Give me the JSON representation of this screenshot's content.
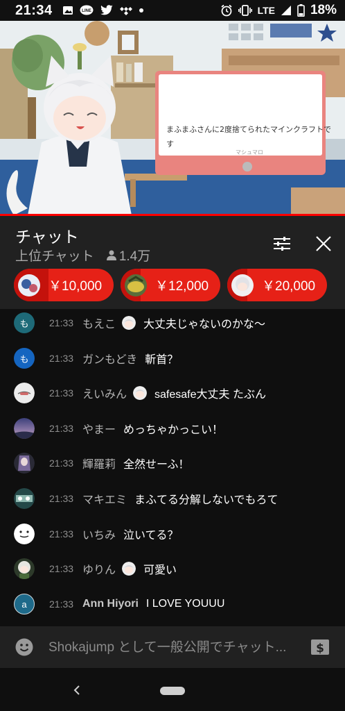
{
  "status_bar": {
    "time": "21:34",
    "network": "LTE",
    "battery": "18%",
    "left_icons": [
      "image-icon",
      "line-app-icon",
      "twitter-icon",
      "tidal-icon",
      "dot-icon"
    ],
    "right_icons": [
      "alarm-icon",
      "vibrate-icon",
      "signal-icon",
      "battery-icon"
    ]
  },
  "video": {
    "overlay_text": "まふまふさんに2度捨てられたマインクラフトです",
    "overlay_sub": "マシュマロ"
  },
  "chat": {
    "title": "チャット",
    "mode": "上位チャット",
    "viewers": "1.4万",
    "tickers": [
      {
        "amount": "￥10,000",
        "progress": 0.35
      },
      {
        "amount": "￥12,000",
        "progress": 0.2
      },
      {
        "amount": "￥20,000",
        "progress": 0.2
      }
    ],
    "messages": [
      {
        "time": "21:33",
        "author": "もえこ",
        "avatar_letter": "も",
        "avatar_color": "#1e6a78",
        "member_badge": true,
        "text": "大丈夫じゃないのかな～"
      },
      {
        "time": "21:33",
        "author": "ガンもどき",
        "avatar_letter": "も",
        "avatar_color": "#1565c0",
        "member_badge": false,
        "text": "斬首？"
      },
      {
        "time": "21:33",
        "author": "えいみん",
        "avatar_letter": "",
        "avatar_color": "#e8e8e8",
        "member_badge": true,
        "text": "safesafe大丈夫 たぶん"
      },
      {
        "time": "21:33",
        "author": "やまー",
        "avatar_letter": "",
        "avatar_color": "#5a5c8c",
        "member_badge": false,
        "text": "めっちゃかっこい！"
      },
      {
        "time": "21:33",
        "author": "輝羅莉",
        "avatar_letter": "",
        "avatar_color": "#3a3a4a",
        "member_badge": false,
        "text": "全然せーふ！"
      },
      {
        "time": "21:33",
        "author": "マキエミ",
        "avatar_letter": "",
        "avatar_color": "#2d5a5a",
        "member_badge": false,
        "text": "まふてる分解しないでもろて"
      },
      {
        "time": "21:33",
        "author": "いちみ",
        "avatar_letter": "",
        "avatar_color": "#ffffff",
        "member_badge": false,
        "text": "泣いてる？"
      },
      {
        "time": "21:33",
        "author": "ゆりん",
        "avatar_letter": "",
        "avatar_color": "#d8d0c0",
        "member_badge": true,
        "text": "可愛い"
      },
      {
        "time": "21:33",
        "author": "Ann Hiyori",
        "avatar_letter": "a",
        "avatar_color": "#1e6a8a",
        "member_badge": false,
        "text": "I LOVE YOUUU"
      }
    ],
    "input_placeholder": "Shokajump として一般公開でチャット..."
  },
  "colors": {
    "accent_red": "#ff0000",
    "ticker_red": "#e62117",
    "panel": "#212121",
    "background": "#0f0f0f"
  }
}
